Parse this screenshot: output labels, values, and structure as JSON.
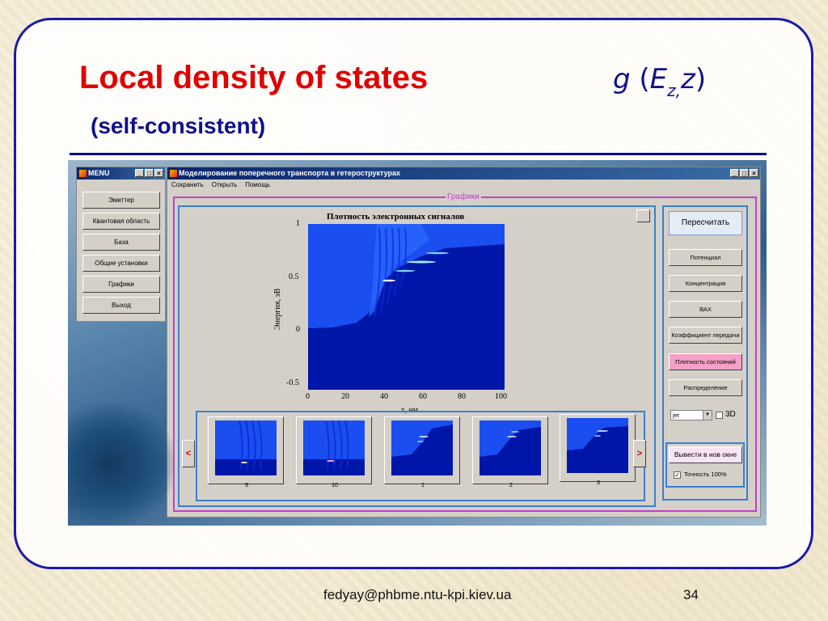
{
  "slide": {
    "title": "Local density of states",
    "formula_g": "g",
    "formula_E": "E",
    "formula_sub": "z,",
    "formula_z": "z",
    "subtitle": "(self-consistent)",
    "footer_email": "fedyay@phbme.ntu-kpi.kiev.ua",
    "page_number": "34"
  },
  "menu_window": {
    "title": "MENU",
    "buttons": [
      "Эмиттер",
      "Квантовая область",
      "База",
      "Общие установки",
      "Графики",
      "Выход"
    ]
  },
  "main_window": {
    "title": "Моделирование поперечного транспорта в гетероструктурах",
    "menubar": [
      "Сохранить",
      "Открыть",
      "Помощь"
    ],
    "group_label": "Графики",
    "plot": {
      "title": "Плотность электронных сигналов",
      "ylabel": "Энергия, эВ",
      "xlabel": "z, нм",
      "yticks": [
        "1",
        "0.5",
        "0",
        "-0.5"
      ],
      "xticks": [
        "0",
        "20",
        "40",
        "60",
        "80",
        "100"
      ]
    },
    "thumbnails": [
      {
        "label": "9"
      },
      {
        "label": "10"
      },
      {
        "label": "1"
      },
      {
        "label": "2"
      },
      {
        "label": "3"
      }
    ],
    "nav_prev": "<",
    "nav_next": ">",
    "right_buttons": {
      "recalc": "Пересчитать",
      "potential": "Потенциал",
      "concentration": "Концентрация",
      "iv": "ВАХ",
      "transmission": "Коэффициент передачи",
      "dos": "Плотность состояний",
      "distribution": "Распределение"
    },
    "colormap_select": "jet",
    "check_3d": "3D",
    "export_button": "Вывести в нов окне",
    "accuracy_check": "Точность 100%"
  },
  "colors": {
    "title_red": "#e00000",
    "navy": "#10108a",
    "frame_blue": "#1a1aa8",
    "plot_blue": "#0016a8",
    "group_magenta": "#c040c8",
    "active_pink": "#f4a0c8"
  }
}
